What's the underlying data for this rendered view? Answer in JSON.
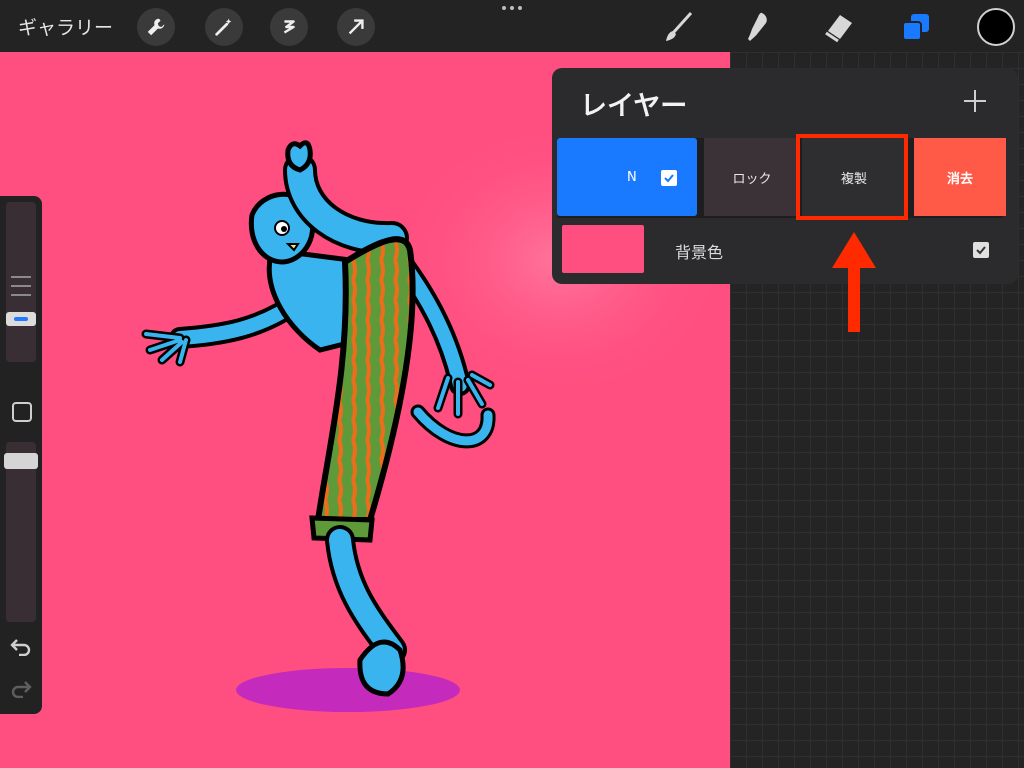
{
  "topbar": {
    "gallery_label": "ギャラリー",
    "left_tools": [
      "wrench-icon",
      "magic-wand-icon",
      "selection-icon",
      "transform-arrow-icon"
    ],
    "right_tools": [
      "brush-icon",
      "smudge-icon",
      "eraser-icon",
      "layers-icon"
    ],
    "current_color": "#000000"
  },
  "layers_panel": {
    "title": "レイヤー",
    "layer_options": {
      "blend_label": "N",
      "visible": true,
      "lock_label": "ロック",
      "duplicate_label": "複製",
      "delete_label": "消去"
    },
    "background_layer": {
      "label": "背景色",
      "color": "#ff4f80",
      "visible": true
    }
  },
  "canvas": {
    "background_color": "#ff4f80"
  },
  "colors": {
    "accent_blue": "#1a7aff",
    "delete_red": "#ff5a47",
    "highlight_red": "#ff2a00"
  }
}
